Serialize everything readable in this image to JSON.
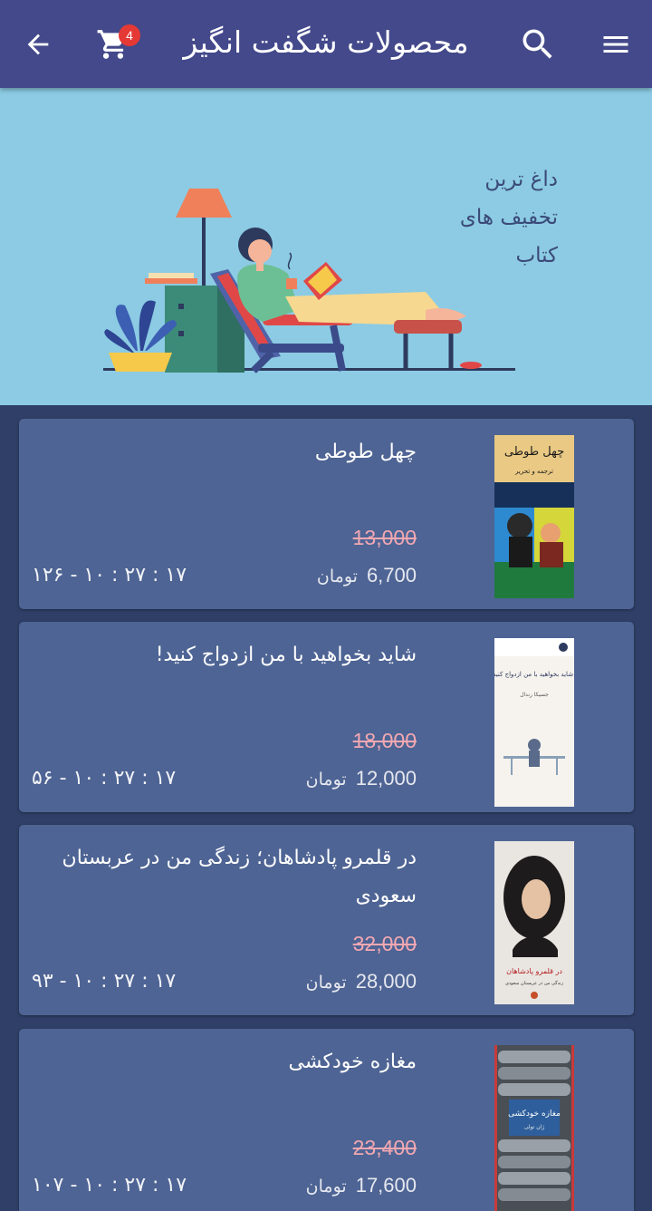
{
  "header": {
    "title": "محصولات شگفت انگیز",
    "cart_count": "4",
    "icons": [
      "back-arrow-icon",
      "cart-icon",
      "search-icon",
      "menu-icon"
    ]
  },
  "banner": {
    "lines": [
      "داغ ترین",
      "تخفیف های",
      "کتاب"
    ]
  },
  "products": [
    {
      "title": "چهل طوطی",
      "old_price": "13,000",
      "new_price": "6,700",
      "currency": "تومان",
      "timer": "۱۲۶ - ۱۰ : ۲۷ : ۱۷",
      "cover": {
        "title": "چهل طوطی",
        "subtitle": "ترجمه و تحریر"
      }
    },
    {
      "title": "شاید بخواهید با من ازدواج کنید!",
      "old_price": "18,000",
      "new_price": "12,000",
      "currency": "تومان",
      "timer": "۵۶ - ۱۰ : ۲۷ : ۱۷",
      "cover": {
        "title": "شاید بخواهید با من ازدواج کنید!",
        "subtitle": "جسیکا رندال"
      }
    },
    {
      "title": "در قلمرو پادشاهان؛ زندگی من در عربستان سعودی",
      "old_price": "32,000",
      "new_price": "28,000",
      "currency": "تومان",
      "timer": "۹۳ - ۱۰ : ۲۷ : ۱۷",
      "cover": {
        "title": "در قلمرو پادشاهان",
        "subtitle": "زندگی من در عربستان سعودی"
      }
    },
    {
      "title": "مغازه خودکشی",
      "old_price": "23,400",
      "new_price": "17,600",
      "currency": "تومان",
      "timer": "۱۰۷ - ۱۰ : ۲۷ : ۱۷",
      "cover": {
        "title": "مغازه خودکشی",
        "subtitle": "ژان تولی"
      }
    }
  ],
  "colors": {
    "appbar": "#43498a",
    "banner": "#8ccbe3",
    "card": "#4e6494",
    "background": "#2f3f67",
    "old_price": "#f2a8b2",
    "badge": "#e53935"
  }
}
